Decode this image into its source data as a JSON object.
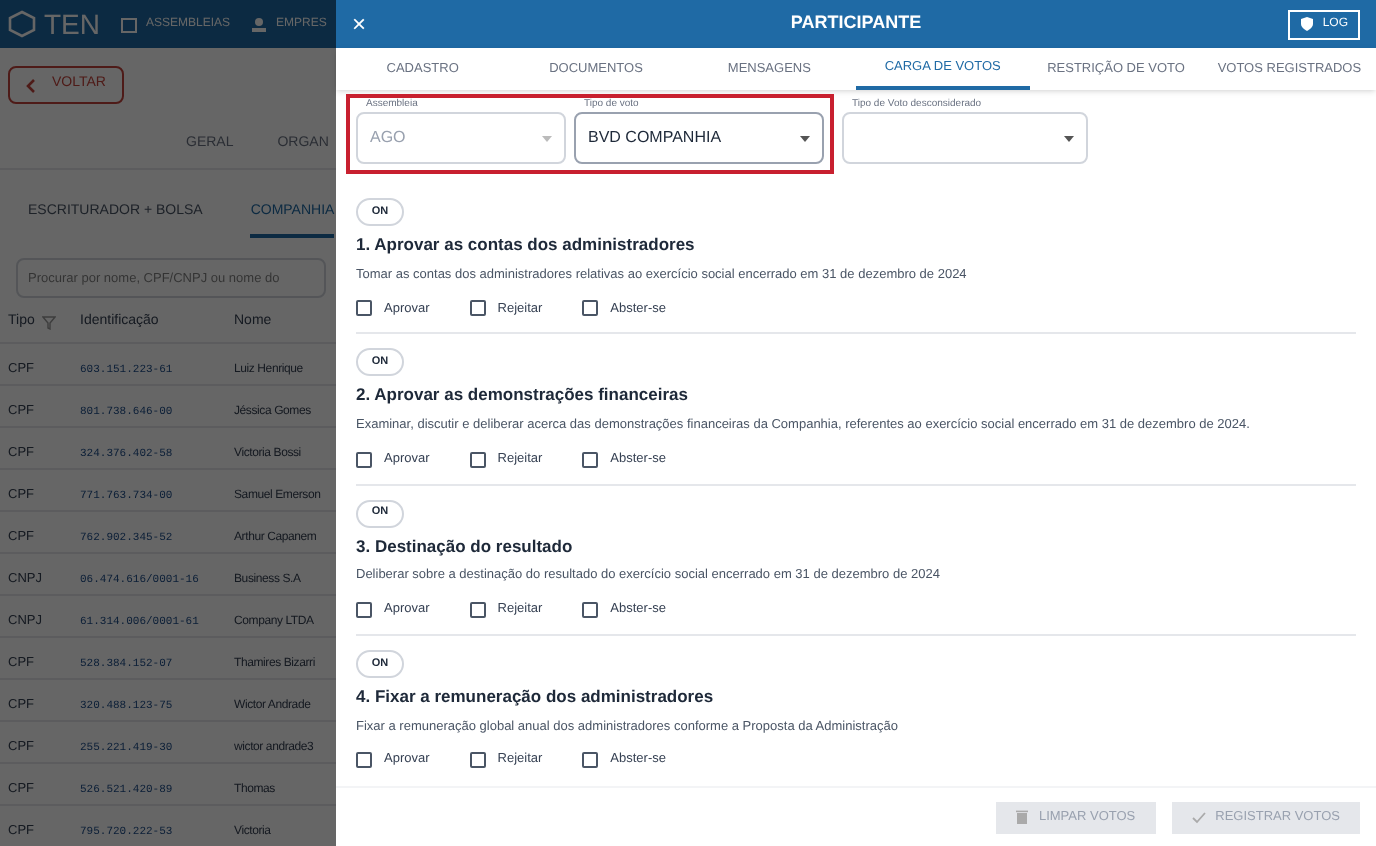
{
  "app": {
    "logo": "TEN",
    "nav": [
      {
        "label": "ASSEMBLEIAS"
      },
      {
        "label": "EMPRES"
      }
    ],
    "back": "VOLTAR",
    "tabs": [
      {
        "label": "GERAL",
        "selected": false
      },
      {
        "label": "ORGAN",
        "selected": false
      }
    ],
    "subtabs": [
      {
        "label": "ESCRITURADOR + BOLSA",
        "selected": false
      },
      {
        "label": "COMPANHIA",
        "selected": true
      }
    ],
    "search": {
      "placeholder": "Procurar por nome, CPF/CNPJ ou nome do"
    },
    "table": {
      "columns": [
        "Tipo",
        "Identificação",
        "Nome"
      ],
      "rows": [
        [
          "CPF",
          "603.151.223-61",
          "Luiz Henrique"
        ],
        [
          "CPF",
          "801.738.646-00",
          "Jéssica Gomes"
        ],
        [
          "CPF",
          "324.376.402-58",
          "Victoria Bossi"
        ],
        [
          "CPF",
          "771.763.734-00",
          "Samuel Emerson"
        ],
        [
          "CPF",
          "762.902.345-52",
          "Arthur Capanem"
        ],
        [
          "CNPJ",
          "06.474.616/0001-16",
          "Business S.A"
        ],
        [
          "CNPJ",
          "61.314.006/0001-61",
          "Company LTDA"
        ],
        [
          "CPF",
          "528.384.152-07",
          "Thamires Bizarri"
        ],
        [
          "CPF",
          "320.488.123-75",
          "Wictor Andrade"
        ],
        [
          "CPF",
          "255.221.419-30",
          "wictor andrade3"
        ],
        [
          "CPF",
          "526.521.420-89",
          "Thomas"
        ],
        [
          "CPF",
          "795.720.222-53",
          "Victoria"
        ]
      ]
    }
  },
  "drawer": {
    "title": "PARTICIPANTE",
    "close": "×",
    "log": "LOG",
    "tabs": [
      {
        "label": "CADASTRO",
        "selected": false
      },
      {
        "label": "DOCUMENTOS",
        "selected": false
      },
      {
        "label": "MENSAGENS",
        "selected": false
      },
      {
        "label": "CARGA DE VOTOS",
        "selected": true
      },
      {
        "label": "RESTRIÇÃO DE VOTO",
        "selected": false
      },
      {
        "label": "VOTOS REGISTRADOS",
        "selected": false
      }
    ],
    "filters": [
      {
        "label": "Assembleia",
        "value": "AGO",
        "disabled": true,
        "highlighted": true
      },
      {
        "label": "Tipo de voto",
        "value": "BVD COMPANHIA",
        "disabled": false,
        "highlighted": true
      },
      {
        "label": "Tipo de Voto desconsiderado",
        "disabled": false,
        "highlighted": false
      }
    ],
    "items": [
      {
        "toggle": "ON",
        "on": true,
        "title": "1. Aprovar as contas dos administradores",
        "description": "Tomar as contas dos administradores relativas ao exercício social encerrado em 31 de dezembro de 2024",
        "options": [
          {
            "label": "Aprovar",
            "checked": false
          },
          {
            "label": "Rejeitar",
            "checked": false
          },
          {
            "label": "Abster-se",
            "checked": false
          }
        ]
      },
      {
        "toggle": "ON",
        "on": true,
        "title": "2. Aprovar as demonstrações financeiras",
        "description": "Examinar, discutir e deliberar acerca das demonstrações financeiras da Companhia, referentes ao exercício social encerrado em 31 de dezembro de 2024.",
        "options": [
          {
            "label": "Aprovar",
            "checked": false
          },
          {
            "label": "Rejeitar",
            "checked": false
          },
          {
            "label": "Abster-se",
            "checked": false
          }
        ]
      },
      {
        "toggle": "ON",
        "on": true,
        "title": "3. Destinação do resultado",
        "description": "Deliberar sobre a destinação do resultado do exercício social encerrado em 31 de dezembro de 2024",
        "options": [
          {
            "label": "Aprovar",
            "checked": false
          },
          {
            "label": "Rejeitar",
            "checked": false
          },
          {
            "label": "Abster-se",
            "checked": false
          }
        ]
      },
      {
        "toggle": "ON",
        "on": true,
        "title": "4. Fixar a remuneração dos administradores",
        "description": "Fixar a remuneração global anual dos administradores conforme a Proposta da Administração",
        "options": [
          {
            "label": "Aprovar",
            "checked": false
          },
          {
            "label": "Rejeitar",
            "checked": false
          },
          {
            "label": "Abster-se",
            "checked": false
          }
        ]
      }
    ],
    "buttons": [
      {
        "label": "LIMPAR VOTOS",
        "kind": "clear",
        "disabled": true
      },
      {
        "label": "REGISTRAR VOTOS",
        "kind": "register",
        "disabled": true
      }
    ]
  }
}
